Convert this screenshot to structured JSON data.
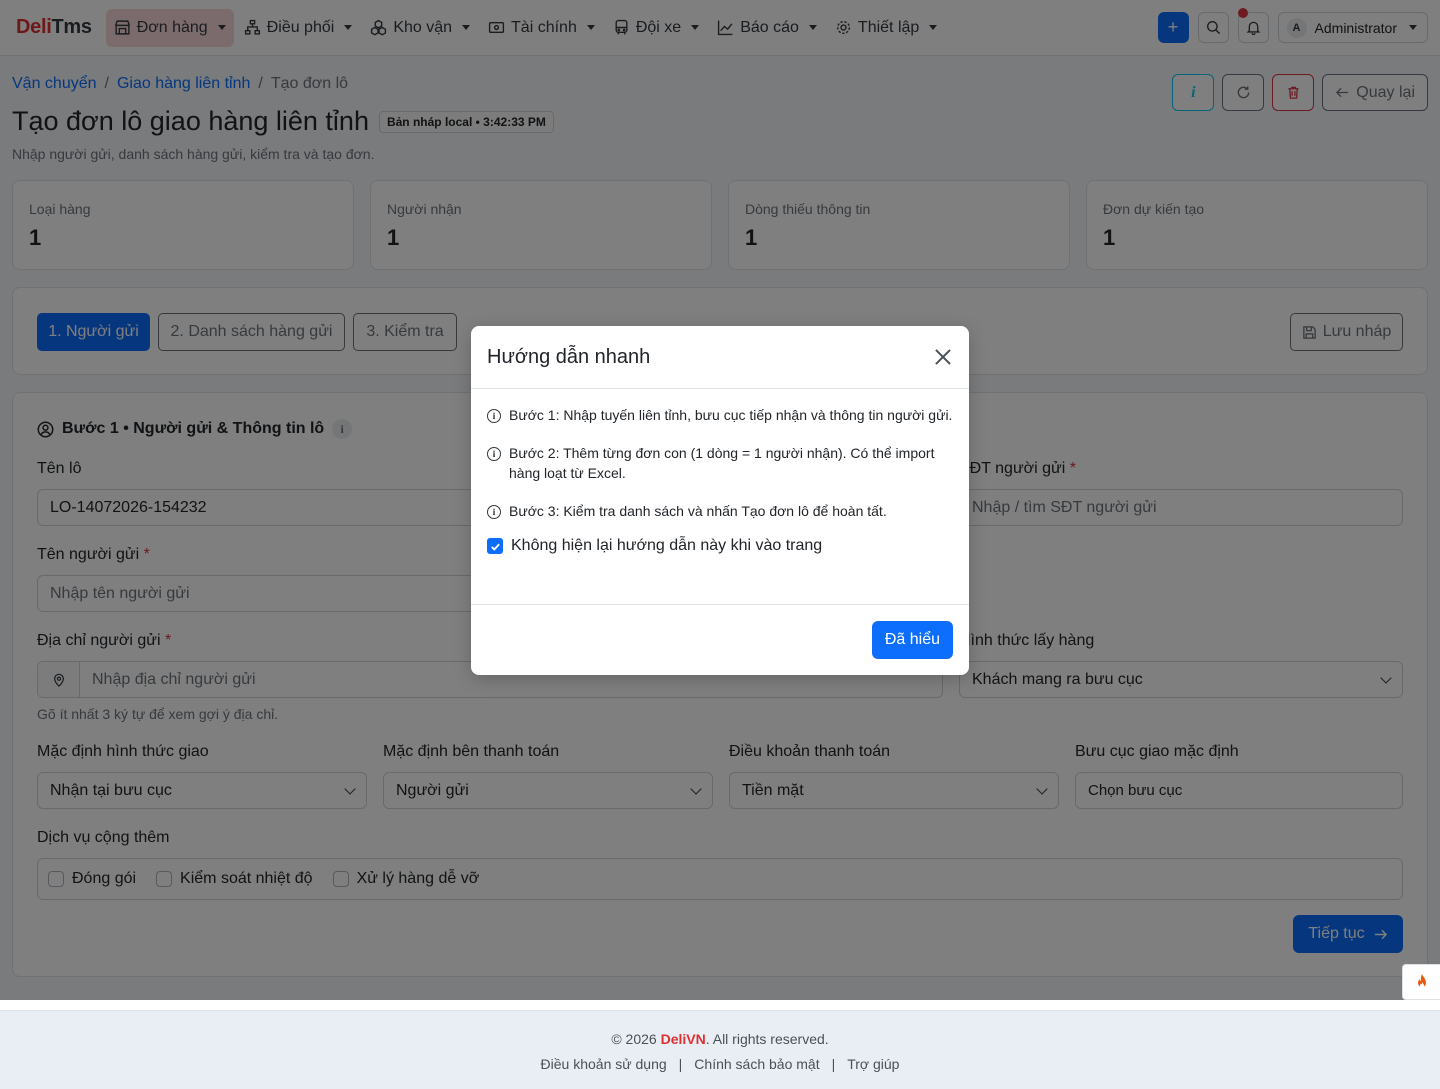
{
  "brand": {
    "part1": "Deli",
    "part2": "Tms"
  },
  "nav": {
    "items": [
      {
        "label": "Đơn hàng"
      },
      {
        "label": "Điều phối"
      },
      {
        "label": "Kho vận"
      },
      {
        "label": "Tài chính"
      },
      {
        "label": "Đội xe"
      },
      {
        "label": "Báo cáo"
      },
      {
        "label": "Thiết lập"
      }
    ],
    "add_label": "+",
    "user": {
      "avatar": "A",
      "name": "Administrator"
    }
  },
  "breadcrumb": {
    "l1": "Vận chuyển",
    "l2": "Giao hàng liên tỉnh",
    "current": "Tạo đơn lô",
    "sep": "/"
  },
  "page": {
    "title": "Tạo đơn lô giao hàng liên tỉnh",
    "draft_badge": "Bản nháp local • 3:42:33 PM",
    "subtitle": "Nhập người gửi, danh sách hàng gửi, kiểm tra và tạo đơn.",
    "info_label": "i",
    "back_label": "Quay lại"
  },
  "stats": [
    {
      "label": "Loại hàng",
      "value": "1"
    },
    {
      "label": "Người nhận",
      "value": "1"
    },
    {
      "label": "Dòng thiếu thông tin",
      "value": "1"
    },
    {
      "label": "Đơn dự kiến tạo",
      "value": "1"
    }
  ],
  "steps": {
    "s1": "1. Người gửi",
    "s2": "2. Danh sách hàng gửi",
    "s3": "3. Kiểm tra",
    "save_draft": "Lưu nháp"
  },
  "form": {
    "section_title": "Bước 1 • Người gửi & Thông tin lô",
    "info_label": "i",
    "batch_name_label": "Tên lô",
    "batch_name_value": "LO-14072026-154232",
    "sender_phone_label": "SĐT người gửi",
    "sender_phone_placeholder": "Nhập / tìm SĐT người gửi",
    "sender_name_label": "Tên người gửi",
    "sender_name_placeholder": "Nhập tên người gửi",
    "sender_address_label": "Địa chỉ người gửi",
    "sender_address_placeholder": "Nhập địa chỉ người gửi",
    "address_hint": "Gõ ít nhất 3 ký tự để xem gợi ý địa chỉ.",
    "pickup_method_label": "Hình thức lấy hàng",
    "pickup_method_value": "Khách mang ra bưu cục",
    "delivery_default_label": "Mặc định hình thức giao",
    "delivery_default_value": "Nhận tại bưu cục",
    "payer_default_label": "Mặc định bên thanh toán",
    "payer_default_value": "Người gửi",
    "payment_terms_label": "Điều khoản thanh toán",
    "payment_terms_value": "Tiền mặt",
    "post_office_label": "Bưu cục giao mặc định",
    "post_office_value": "Chọn bưu cục",
    "services_label": "Dịch vụ cộng thêm",
    "services": [
      "Đóng gói",
      "Kiểm soát nhiệt độ",
      "Xử lý hàng dễ vỡ"
    ],
    "next_label": "Tiếp tục",
    "required_mark": "*"
  },
  "modal": {
    "title": "Hướng dẫn nhanh",
    "tips": [
      "Bước 1: Nhập tuyến liên tỉnh, bưu cục tiếp nhận và thông tin người gửi.",
      "Bước 2: Thêm từng đơn con (1 dòng = 1 người nhận). Có thể import hàng loạt từ Excel.",
      "Bước 3: Kiểm tra danh sách và nhấn Tạo đơn lô để hoàn tất."
    ],
    "tip_icon": "i",
    "checkbox_label": "Không hiện lại hướng dẫn này khi vào trang",
    "checkbox_checked": true,
    "ok_label": "Đã hiểu"
  },
  "footer": {
    "copy_prefix": "© 2026 ",
    "copy_brand": "DeliVN",
    "copy_suffix": ". All rights reserved.",
    "links": [
      "Điều khoản sử dụng",
      "Chính sách bảo mật",
      "Trợ giúp"
    ],
    "link_sep": "|"
  },
  "colors": {
    "primary": "#0d6efd",
    "brand_red": "#e03131",
    "danger": "#dc3545",
    "info": "#0dcaf0"
  }
}
